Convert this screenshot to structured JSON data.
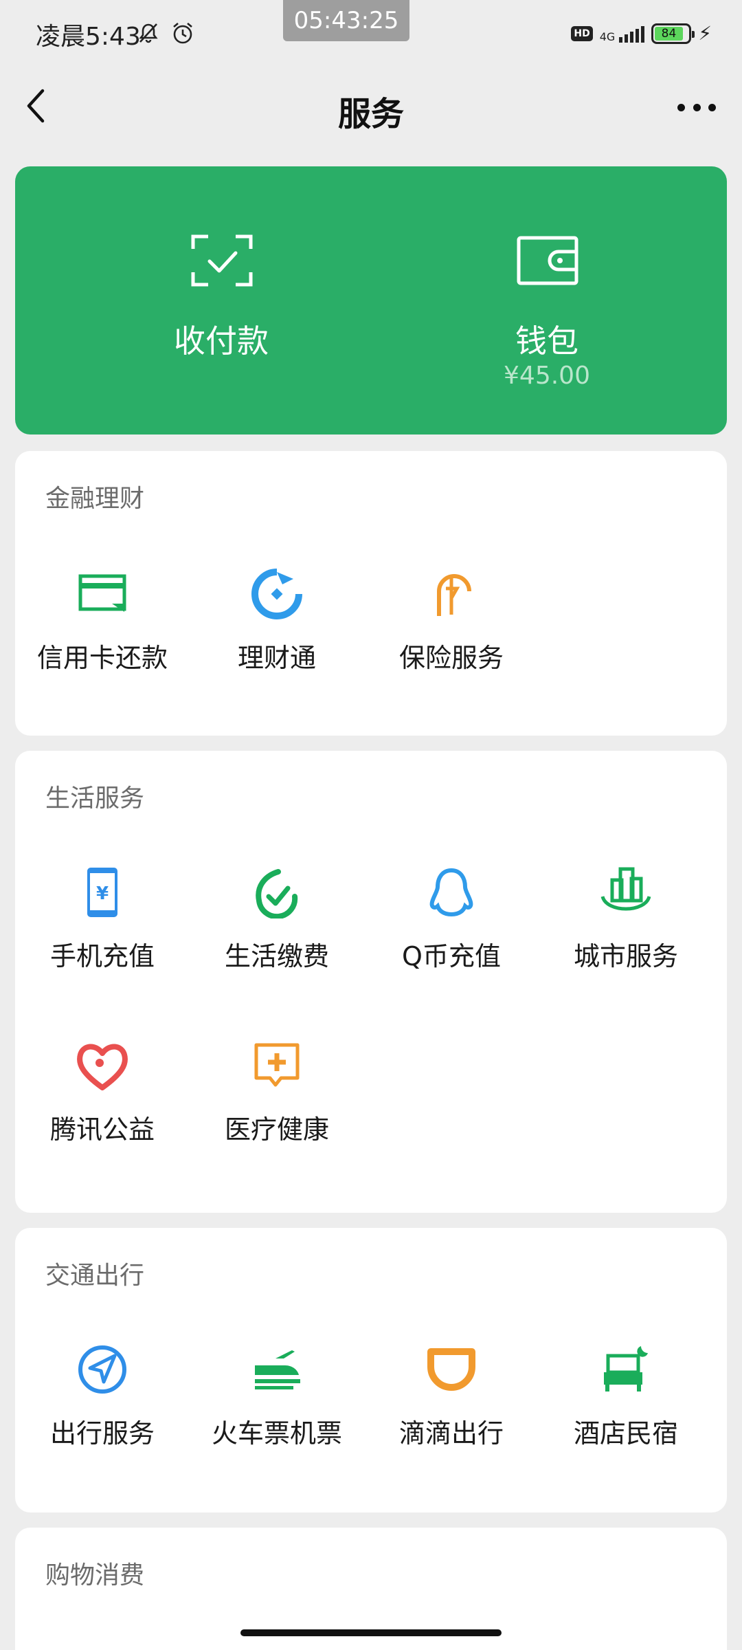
{
  "status_bar": {
    "time": "凌晨5:43",
    "overlay_time": "05:43:25",
    "hd": "HD",
    "network": "4G",
    "battery": "84",
    "icons": [
      "silent-bell-icon",
      "alarm-icon",
      "signal-icon",
      "battery-icon",
      "charging-icon"
    ]
  },
  "nav": {
    "title": "服务",
    "back_icon": "chevron-left-icon",
    "more_icon": "more-dots-icon"
  },
  "pay_card": {
    "color": "#2aae67",
    "collect": {
      "label": "收付款",
      "icon": "scan-check-icon"
    },
    "wallet": {
      "label": "钱包",
      "amount": "¥45.00",
      "icon": "wallet-icon"
    }
  },
  "sections": {
    "finance": {
      "title": "金融理财",
      "items": [
        {
          "label": "信用卡还款",
          "icon": "credit-card-icon",
          "color": "#1aad5a"
        },
        {
          "label": "理财通",
          "icon": "licaitong-icon",
          "color": "#2f9bea"
        },
        {
          "label": "保险服务",
          "icon": "insurance-icon",
          "color": "#f19a2e"
        }
      ]
    },
    "life": {
      "title": "生活服务",
      "items": [
        {
          "label": "手机充值",
          "icon": "phone-topup-icon",
          "color": "#2f8ee8"
        },
        {
          "label": "生活缴费",
          "icon": "bill-pay-icon",
          "color": "#1aad5a"
        },
        {
          "label": "Q币充值",
          "icon": "qq-penguin-icon",
          "color": "#2f9bea"
        },
        {
          "label": "城市服务",
          "icon": "city-building-icon",
          "color": "#1aad5a"
        },
        {
          "label": "腾讯公益",
          "icon": "charity-heart-icon",
          "color": "#e9504f"
        },
        {
          "label": "医疗健康",
          "icon": "medical-plus-icon",
          "color": "#f19a2e"
        }
      ]
    },
    "travel": {
      "title": "交通出行",
      "items": [
        {
          "label": "出行服务",
          "icon": "navigation-arrow-icon",
          "color": "#2f8ee8"
        },
        {
          "label": "火车票机票",
          "icon": "train-plane-icon",
          "color": "#1aad5a"
        },
        {
          "label": "滴滴出行",
          "icon": "didi-icon",
          "color": "#f19a2e"
        },
        {
          "label": "酒店民宿",
          "icon": "hotel-bed-icon",
          "color": "#1aad5a"
        }
      ]
    },
    "shopping": {
      "title": "购物消费"
    }
  }
}
